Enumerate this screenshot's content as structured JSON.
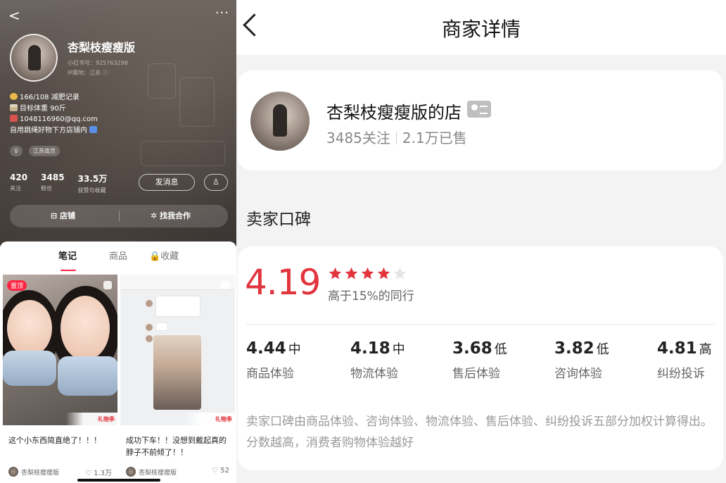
{
  "left": {
    "topbar": {
      "back_glyph": "<",
      "more_glyph": "···"
    },
    "profile": {
      "nickname": "杏梨枝瘦瘦版",
      "red_id": "小红书号：925763298",
      "ip_location": "IP属地：江苏 ⓘ",
      "bio": [
        {
          "icon": "coin-icon",
          "text": "166/108 减肥记录"
        },
        {
          "icon": "hourglass-icon",
          "text": "目标体重 90斤"
        },
        {
          "icon": "mail-icon",
          "text": "1048116960@qq.com"
        },
        {
          "icon": "",
          "text": "自用跳绳好物下方店铺内"
        }
      ],
      "tags": [
        "♀",
        "江苏南京"
      ],
      "stats": [
        {
          "num": "420",
          "label": "关注"
        },
        {
          "num": "3485",
          "label": "粉丝"
        },
        {
          "num": "33.5万",
          "label": "获赞与收藏"
        }
      ],
      "message_button": "发消息",
      "follow_glyph": "♙",
      "actions": {
        "shop": "⊟ 店铺",
        "coop": "✲ 找我合作"
      }
    },
    "tabs": [
      "笔记",
      "商品",
      "🔒收藏"
    ],
    "cards": [
      {
        "badge": "置顶",
        "gift": "礼物季",
        "title": "这个小东西简直绝了！！！",
        "author": "杏梨枝瘦瘦版",
        "likes": "♡ 1.3万"
      },
      {
        "gift": "礼物季",
        "title": "成功下车！！没想到戴起真的脖子不前倾了！！",
        "author": "杏梨枝瘦瘦版",
        "likes": "♡ 52"
      }
    ]
  },
  "right": {
    "title": "商家详情",
    "shop": {
      "name": "杏梨枝瘦瘦版的店",
      "follows": "3485关注",
      "sold": "2.1万已售"
    },
    "section_title": "卖家口碑",
    "rating": {
      "score": "4.19",
      "stars_filled": 4,
      "stars_total": 5,
      "higher_than": "高于15%的同行",
      "metrics": [
        {
          "score": "4.44",
          "level": "中",
          "label": "商品体验"
        },
        {
          "score": "4.18",
          "level": "中",
          "label": "物流体验"
        },
        {
          "score": "3.68",
          "level": "低",
          "label": "售后体验"
        },
        {
          "score": "3.82",
          "level": "低",
          "label": "咨询体验"
        },
        {
          "score": "4.81",
          "level": "高",
          "label": "纠纷投诉"
        }
      ],
      "note": "卖家口碑由商品体验、咨询体验、物流体验、售后体验、纠纷投诉五部分加权计算得出。分数越高，消费者购物体验越好"
    },
    "colors": {
      "accent": "#e2343c",
      "star_filled": "#e2343c",
      "star_empty": "#e5e5e5"
    }
  }
}
